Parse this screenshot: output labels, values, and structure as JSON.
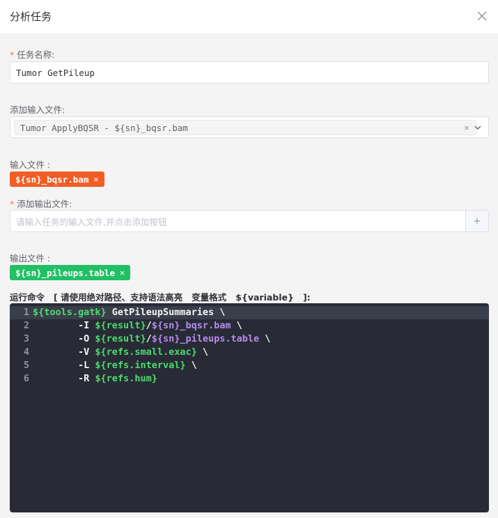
{
  "dialog": {
    "title": "分析任务"
  },
  "task_name": {
    "label": "任务名称:",
    "value": "Tumor GetPileup"
  },
  "add_input": {
    "label": "添加输入文件:",
    "selected_tag": "Tumor ApplyBQSR - ${sn}_bqsr.bam"
  },
  "input_files": {
    "label": "输入文件 :",
    "chips": [
      "${sn}_bqsr.bam"
    ]
  },
  "add_output": {
    "label": "添加输出文件:",
    "placeholder": "请输入任务的输入文件,并点击添加按钮",
    "add_symbol": "+"
  },
  "output_files": {
    "label": "输出文件 :",
    "chips": [
      "${sn}_pileups.table"
    ]
  },
  "command": {
    "label": "运行命令   [ 请使用绝对路径、支持语法高亮   变量格式   ${variable}   ]:",
    "lines": [
      {
        "num": "1",
        "indent": "",
        "flag": "",
        "v1": "${tools.gatk}",
        "mid": "",
        "v2": "",
        "tail": " GetPileupSummaries \\"
      },
      {
        "num": "2",
        "indent": "        ",
        "flag": "-I ",
        "v1": "${result}",
        "mid": "/",
        "v2": "${sn}_bqsr.bam",
        "tail": " \\"
      },
      {
        "num": "3",
        "indent": "        ",
        "flag": "-O ",
        "v1": "${result}",
        "mid": "/",
        "v2": "${sn}_pileups.table",
        "tail": " \\"
      },
      {
        "num": "4",
        "indent": "        ",
        "flag": "-V ",
        "v1": "${refs.small.exac}",
        "mid": "",
        "v2": "",
        "tail": " \\"
      },
      {
        "num": "5",
        "indent": "        ",
        "flag": "-L ",
        "v1": "${refs.interval}",
        "mid": "",
        "v2": "",
        "tail": " \\"
      },
      {
        "num": "6",
        "indent": "        ",
        "flag": "-R ",
        "v1": "${refs.hum}",
        "mid": "",
        "v2": "",
        "tail": ""
      }
    ]
  },
  "colors": {
    "required": "#f56c6c",
    "input_chip": "#f25d25",
    "output_chip": "#22c064",
    "editor_bg": "#282b35",
    "var_green": "#4ddc6f",
    "var_purple": "#b58cf0"
  },
  "icons": {
    "close": "close-icon",
    "dropdown": "chevron-down-icon",
    "add": "plus-icon"
  }
}
